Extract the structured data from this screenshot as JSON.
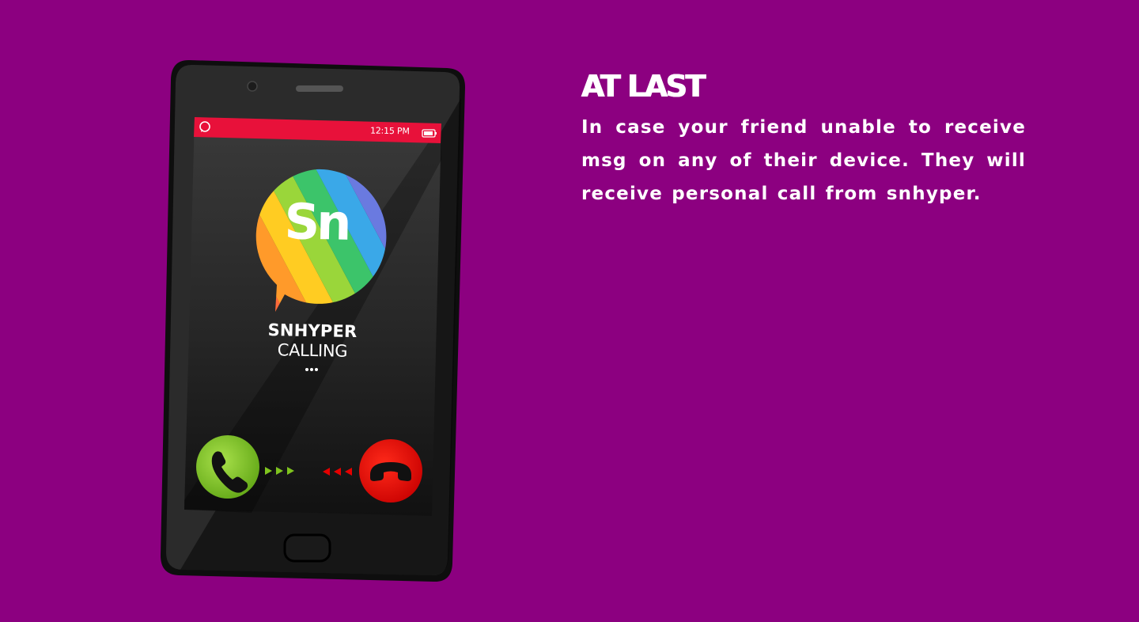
{
  "page": {
    "background_color": "#8c0080"
  },
  "phone": {
    "status_bar": {
      "time": "12:15 PM",
      "app_icon": "whatsapp-icon",
      "battery_icon": "battery-icon",
      "bar_color": "#e8113a"
    },
    "caller": {
      "logo_text": "Sn",
      "name": "SNHYPER",
      "status": "CALLING"
    },
    "actions": {
      "accept_icon": "phone-accept-icon",
      "accept_color": "#7fc41e",
      "decline_icon": "phone-decline-icon",
      "decline_color": "#e50000"
    }
  },
  "content": {
    "heading": "AT LAST",
    "body": "In case your friend unable to receive msg on any of their device. They will receive personal call from snhyper."
  }
}
